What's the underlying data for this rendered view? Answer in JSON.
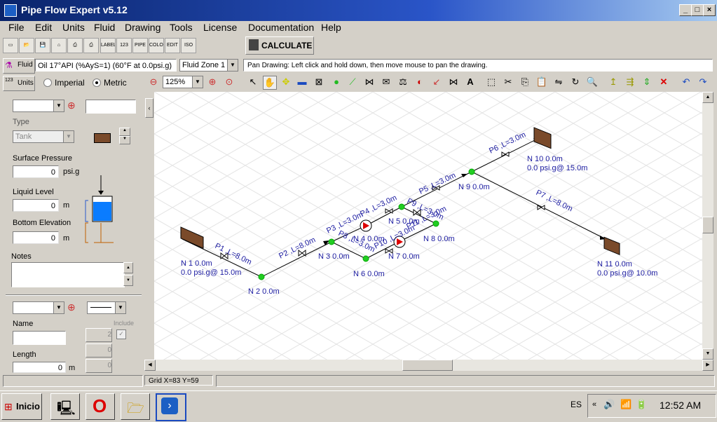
{
  "window": {
    "title": "Pipe Flow Expert v5.12"
  },
  "menu": [
    "File",
    "Edit",
    "Units",
    "Fluid",
    "Drawing",
    "Tools",
    "License",
    "Documentation",
    "Help"
  ],
  "toolbar": {
    "calculate_label": "CALCULATE",
    "small_labels": [
      "LABEL",
      "123",
      "PIPE",
      "COLOR",
      "EDIT",
      "ISO"
    ]
  },
  "fluid_bar": {
    "fluid_label": "Fluid",
    "fluid_value": "Oil 17°API (%AyS=1) (60°F at 0.0psi.g)",
    "zone_value": "Fluid Zone 1",
    "status": "Pan Drawing: Left click and hold down, then move mouse to pan the drawing."
  },
  "units_bar": {
    "units_label": "Units",
    "imperial": "Imperial",
    "metric": "Metric",
    "zoom": "125%"
  },
  "left_panel": {
    "type_label": "Type",
    "type_value": "Tank",
    "surface_pressure_label": "Surface Pressure",
    "surface_pressure_value": "0",
    "surface_pressure_unit": "psi.g",
    "liquid_level_label": "Liquid Level",
    "liquid_level_value": "0",
    "liquid_level_unit": "m",
    "bottom_elev_label": "Bottom Elevation",
    "bottom_elev_value": "0",
    "bottom_elev_unit": "m",
    "notes_label": "Notes",
    "name_label": "Name",
    "length_label": "Length",
    "length_value": "0",
    "length_unit": "m",
    "include_label": "Include",
    "fitting_counts": [
      "2",
      "0",
      "0"
    ]
  },
  "diagram": {
    "pipes": [
      {
        "label": "P1 ,L=8.0m"
      },
      {
        "label": "P2 ,L=8.0m"
      },
      {
        "label": "P3 ,L=3.0m"
      },
      {
        "label": "P4 ,L=3.0m"
      },
      {
        "label": "P5 ,L=3.0m"
      },
      {
        "label": "P6 ,L=3.0m"
      },
      {
        "label": "P7 ,L=8.0m"
      },
      {
        "label": "P8 ,L=3.0m"
      },
      {
        "label": "P9 ,L=3.0m"
      },
      {
        "label": "P10 ,L=3.0m"
      },
      {
        "label": "P11 ,L=3.0m"
      }
    ],
    "nodes": [
      {
        "name": "N 1  0.0m",
        "pressure": "0.0 psi.g@ 15.0m"
      },
      {
        "name": "N 2  0.0m"
      },
      {
        "name": "N 3  0.0m"
      },
      {
        "name": "N 4  0.0m"
      },
      {
        "name": "N 5  0.0m"
      },
      {
        "name": "N 6  0.0m"
      },
      {
        "name": "N 7  0.0m"
      },
      {
        "name": "N 8  0.0m"
      },
      {
        "name": "N 9  0.0m"
      },
      {
        "name": "N 10  0.0m",
        "pressure": "0.0 psi.g@ 15.0m"
      },
      {
        "name": "N 11  0.0m",
        "pressure": "0.0 psi.g@ 10.0m"
      }
    ]
  },
  "statusbar": {
    "grid": "Grid  X=83  Y=59"
  },
  "taskbar": {
    "start": "Inicio",
    "lang": "ES",
    "clock": "12:52 AM"
  },
  "colors": {
    "diagram_text": "#1a1aa0",
    "node": "#22cc22",
    "tank": "#7a4a2a",
    "titlebar": "#0a246a"
  }
}
